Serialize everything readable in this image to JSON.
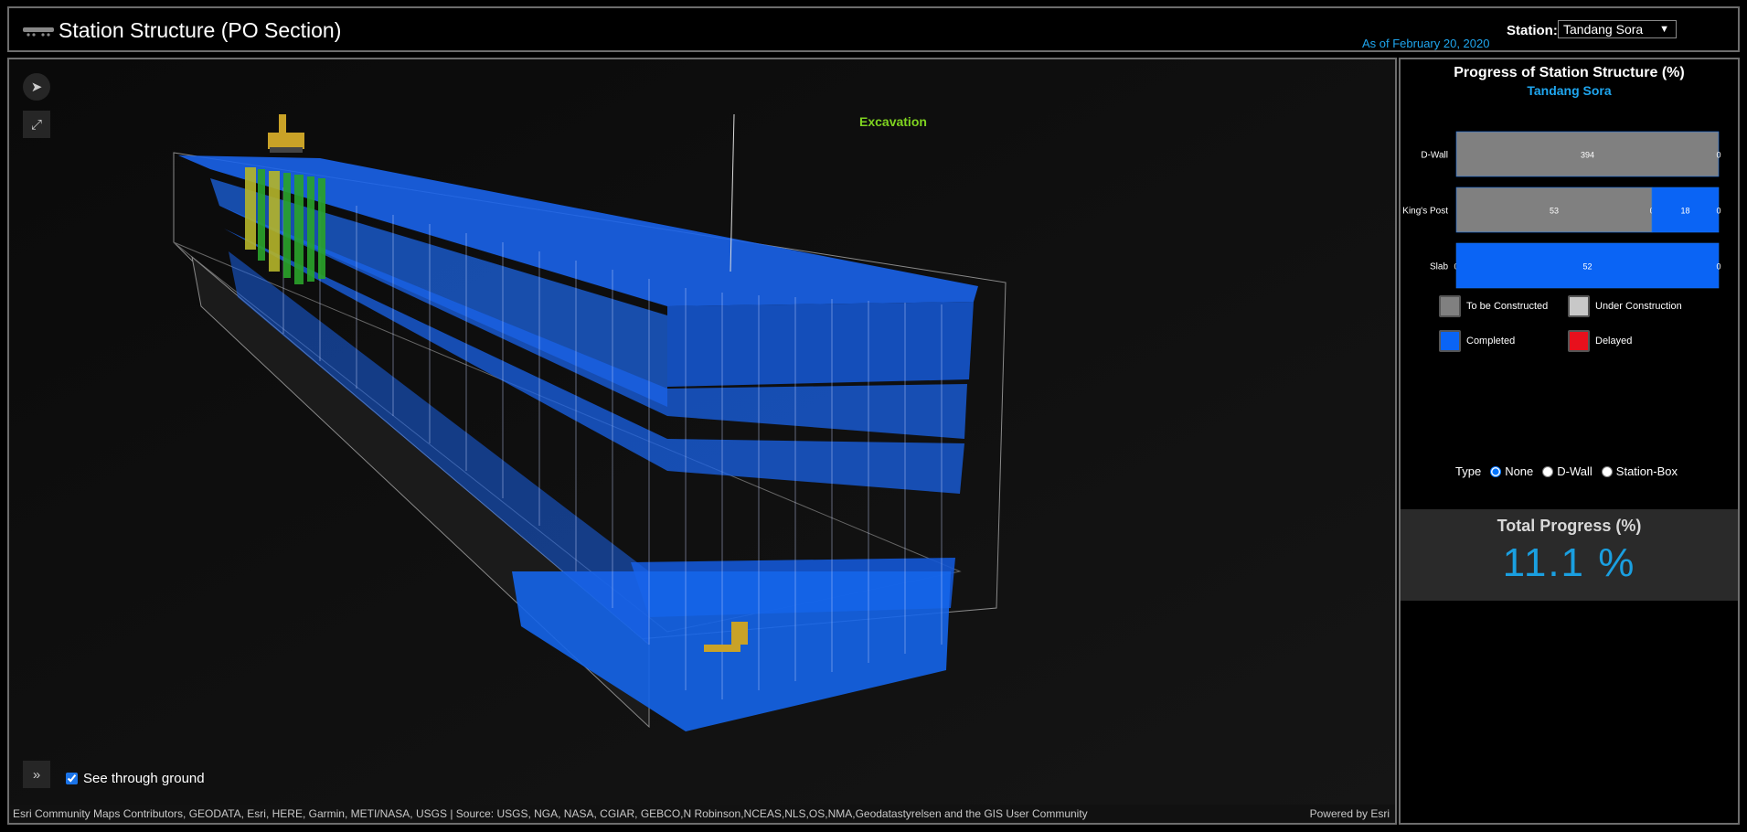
{
  "header": {
    "title": "Station Structure (PO Section)",
    "as_of": "As of February 20, 2020",
    "station_label": "Station:",
    "station_value": "Tandang Sora"
  },
  "scene": {
    "annotation": "Excavation",
    "see_through_label": "See through ground",
    "see_through_checked": true,
    "attribution": "Esri Community Maps Contributors, GEODATA, Esri, HERE, Garmin, METI/NASA, USGS | Source: USGS, NGA, NASA, CGIAR, GEBCO,N Robinson,NCEAS,NLS,OS,NMA,Geodatastyrelsen and the GIS User Community",
    "powered_by": "Powered by Esri",
    "icons": {
      "navigation": "compass-arrow-icon",
      "fullscreen": "fullscreen-icon",
      "expand": "double-chevron-right-icon",
      "app": "train-icon"
    }
  },
  "panel": {
    "title": "Progress of Station Structure (%)",
    "subtitle": "Tandang Sora",
    "legend": [
      {
        "label": "To be Constructed",
        "color": "#808080"
      },
      {
        "label": "Under Construction",
        "color": "#c8c8c8"
      },
      {
        "label": "Completed",
        "color": "#0a64f5"
      },
      {
        "label": "Delayed",
        "color": "#e8101c"
      }
    ],
    "type_label": "Type",
    "type_options": [
      "None",
      "D-Wall",
      "Station-Box"
    ],
    "type_selected": "None",
    "total_title": "Total Progress (%)",
    "total_value": "11.1 %"
  },
  "chart_data": {
    "type": "bar",
    "orientation": "horizontal",
    "stacked": true,
    "categories": [
      "D-Wall",
      "King's Post",
      "Slab"
    ],
    "xlim": [
      0,
      100
    ],
    "xticks": [
      "0",
      "50",
      "100"
    ],
    "segments": [
      [
        {
          "status": "To be Constructed",
          "percent": 100,
          "label": "394"
        },
        {
          "status": "Completed",
          "percent": 0,
          "label": "0"
        }
      ],
      [
        {
          "status": "To be Constructed",
          "percent": 74.6,
          "label": "53"
        },
        {
          "status": "Under Construction",
          "percent": 0,
          "label": "0"
        },
        {
          "status": "Completed",
          "percent": 25.4,
          "label": "18"
        },
        {
          "status": "Delayed",
          "percent": 0,
          "label": "0"
        }
      ],
      [
        {
          "status": "To be Constructed",
          "percent": 0,
          "label": "0"
        },
        {
          "status": "Completed",
          "percent": 100,
          "label": "52"
        },
        {
          "status": "Delayed",
          "percent": 0,
          "label": "0"
        }
      ]
    ],
    "colors": {
      "To be Constructed": "#808080",
      "Under Construction": "#c8c8c8",
      "Completed": "#0a64f5",
      "Delayed": "#e8101c"
    }
  }
}
